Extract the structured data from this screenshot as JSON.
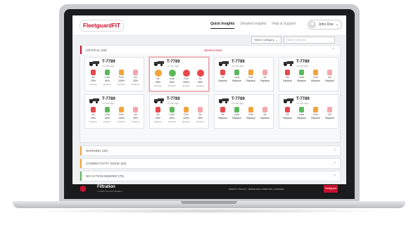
{
  "colors": {
    "brand_red": "#c8102e",
    "warning": "#f2a33a",
    "connectivity": "#f2a33a",
    "ok": "#5cb85c"
  },
  "nav": {
    "logo_part1": "Fleetguard",
    "logo_part2": "FIT",
    "tabs": [
      "Quick Insights",
      "Detailed Insights",
      "Help & Support"
    ],
    "user_name": "John Doe"
  },
  "filters": {
    "category_label": "Select Category",
    "search_placeholder": "Search vehicles"
  },
  "critical": {
    "label": "CRITICAL (20)",
    "note": "Service Now"
  },
  "cards": [
    {
      "id": "T-7789",
      "ago": "14 min ago",
      "filters": [
        {
          "label": "Air",
          "pct": "25%",
          "status": "Replace",
          "color": "#e8474c",
          "round": false
        },
        {
          "label": "Lube",
          "pct": "60%",
          "status": "Replace",
          "color": "#5cb85c",
          "round": false
        },
        {
          "label": "Fuel",
          "pct": "100%",
          "status": "Replace",
          "color": "#f2a33a",
          "round": false
        },
        {
          "label": "Air",
          "pct": "25%",
          "status": "Replace",
          "color": "#f4a6ac",
          "round": false
        }
      ]
    },
    {
      "id": "T-7789",
      "ago": "14 min ago",
      "filters": [
        {
          "label": "Air",
          "pct": "25%",
          "status": "Replace",
          "color": "#f2a33a",
          "round": true
        },
        {
          "label": "Lube",
          "pct": "60%",
          "status": "Replace",
          "color": "#5cb85c",
          "round": true
        },
        {
          "label": "Fuel",
          "pct": "100%",
          "status": "Replace",
          "color": "#e8474c",
          "round": true
        },
        {
          "label": "Air",
          "pct": "25%",
          "status": "Replace",
          "color": "#e8474c",
          "round": true
        }
      ]
    },
    {
      "id": "T-7789",
      "ago": "14 min ago",
      "filters": [
        {
          "label": "Air",
          "pct": "Replace",
          "status": "",
          "color": "#e8474c",
          "round": false
        },
        {
          "label": "Lube",
          "pct": "Replace",
          "status": "",
          "color": "#5cb85c",
          "round": false
        },
        {
          "label": "Fuel",
          "pct": "Replace",
          "status": "",
          "color": "#f2a33a",
          "round": false
        },
        {
          "label": "Air",
          "pct": "Replace",
          "status": "",
          "color": "#f4a6ac",
          "round": false
        }
      ]
    },
    {
      "id": "T-7789",
      "ago": "14 min ago",
      "filters": [
        {
          "label": "Air",
          "pct": "Replace",
          "status": "",
          "color": "#e8474c",
          "round": false
        },
        {
          "label": "Lube",
          "pct": "Replace",
          "status": "",
          "color": "#5cb85c",
          "round": false
        },
        {
          "label": "Fuel",
          "pct": "Replace",
          "status": "",
          "color": "#f2a33a",
          "round": false
        },
        {
          "label": "Air",
          "pct": "Replace",
          "status": "",
          "color": "#f4a6ac",
          "round": false
        }
      ]
    },
    {
      "id": "T-7789",
      "ago": "14 min ago",
      "filters": [
        {
          "label": "Air",
          "pct": "25%",
          "status": "Replace",
          "color": "#e8474c",
          "round": false
        },
        {
          "label": "Lube",
          "pct": "60%",
          "status": "Replace",
          "color": "#5cb85c",
          "round": false
        },
        {
          "label": "Fuel",
          "pct": "100%",
          "status": "Replace",
          "color": "#f2a33a",
          "round": false
        },
        {
          "label": "Air",
          "pct": "25%",
          "status": "Replace",
          "color": "#f4a6ac",
          "round": false
        }
      ]
    },
    {
      "id": "T-7789",
      "ago": "14 min ago",
      "filters": [
        {
          "label": "Air",
          "pct": "25%",
          "status": "Replace",
          "color": "#e8474c",
          "round": false
        },
        {
          "label": "Lube",
          "pct": "60%",
          "status": "Replace",
          "color": "#5cb85c",
          "round": false
        },
        {
          "label": "Fuel",
          "pct": "100%",
          "status": "Replace",
          "color": "#f2a33a",
          "round": false
        },
        {
          "label": "Air",
          "pct": "25%",
          "status": "Replace",
          "color": "#f4a6ac",
          "round": false
        }
      ]
    },
    {
      "id": "T-7789",
      "ago": "14 min ago",
      "filters": [
        {
          "label": "Air",
          "pct": "Replace",
          "status": "",
          "color": "#e8474c",
          "round": false
        },
        {
          "label": "Lube",
          "pct": "Replace",
          "status": "",
          "color": "#5cb85c",
          "round": false
        },
        {
          "label": "Fuel",
          "pct": "Replace",
          "status": "",
          "color": "#f2a33a",
          "round": false
        },
        {
          "label": "Air",
          "pct": "Replace",
          "status": "",
          "color": "#f4a6ac",
          "round": false
        }
      ]
    },
    {
      "id": "T-7789",
      "ago": "14 min ago",
      "filters": [
        {
          "label": "Air",
          "pct": "Replace",
          "status": "",
          "color": "#e8474c",
          "round": false
        },
        {
          "label": "Lube",
          "pct": "Replace",
          "status": "",
          "color": "#5cb85c",
          "round": false
        },
        {
          "label": "Fuel",
          "pct": "Replace",
          "status": "",
          "color": "#f2a33a",
          "round": false
        },
        {
          "label": "Air",
          "pct": "Replace",
          "status": "",
          "color": "#f4a6ac",
          "round": false
        }
      ]
    }
  ],
  "sections": {
    "warning": "WARNING (20)",
    "connectivity": "CONNECTIVITY ISSUE (20)",
    "no_action": "NO ACTION NEEDED (70)"
  },
  "footer": {
    "title": "Filtration",
    "copyright": "© 2018 Cummins Filtration",
    "links": "PRIVACY POLICY   |   TERMS AND CONDITION   |   COOKIES",
    "badge": "Fleetguard"
  }
}
